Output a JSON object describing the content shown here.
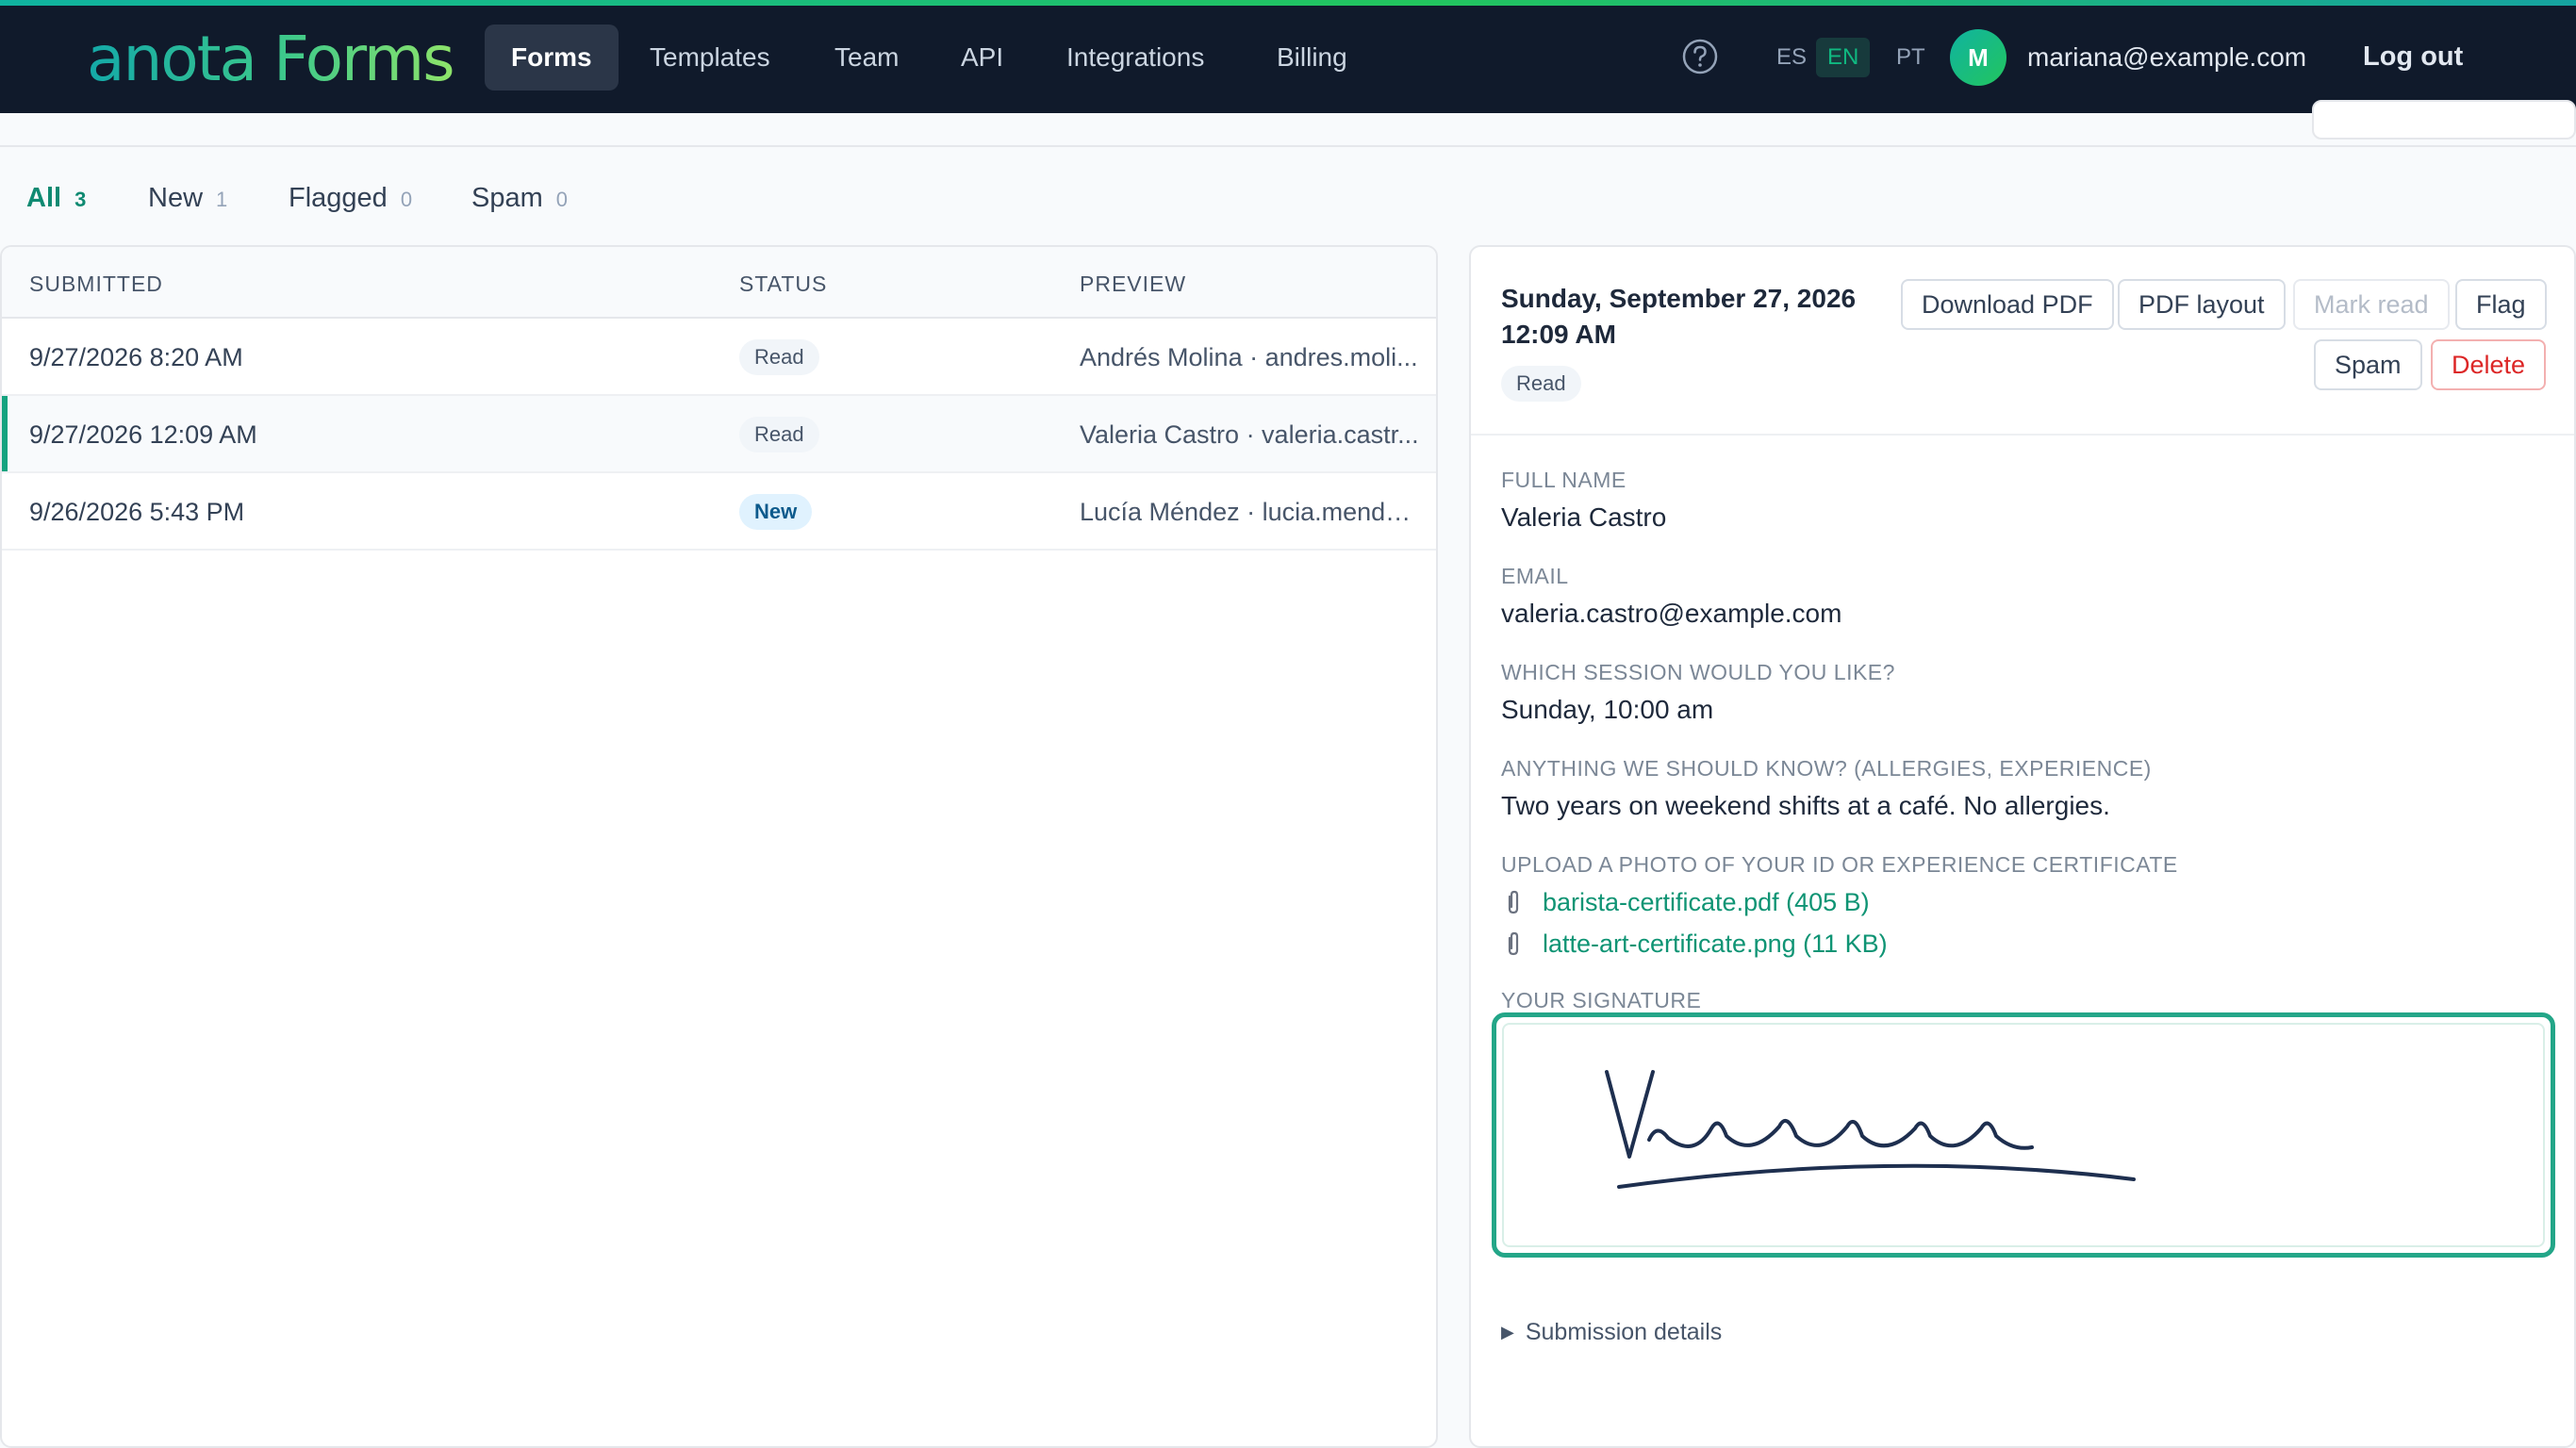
{
  "app": {
    "logo": "anota Forms",
    "nav": [
      {
        "label": "Forms",
        "active": true
      },
      {
        "label": "Templates",
        "active": false
      },
      {
        "label": "Team",
        "active": false
      },
      {
        "label": "API",
        "active": false
      },
      {
        "label": "Integrations",
        "active": false
      },
      {
        "label": "Billing",
        "active": false
      }
    ],
    "help_icon": "question-circle-icon",
    "languages": [
      {
        "code": "ES",
        "active": false
      },
      {
        "code": "EN",
        "active": true
      },
      {
        "code": "PT",
        "active": false
      }
    ],
    "user": {
      "initial": "M",
      "email": "mariana@example.com"
    },
    "logout_label": "Log out",
    "colors": {
      "accent": "#14a37f",
      "nav_bg": "#101a2b",
      "danger": "#dc2626"
    }
  },
  "filters": [
    {
      "label": "All",
      "count": "3",
      "active": true
    },
    {
      "label": "New",
      "count": "1",
      "active": false
    },
    {
      "label": "Flagged",
      "count": "0",
      "active": false
    },
    {
      "label": "Spam",
      "count": "0",
      "active": false
    }
  ],
  "table": {
    "columns": [
      "SUBMITTED",
      "STATUS",
      "PREVIEW"
    ],
    "rows": [
      {
        "submitted": "9/27/2026 8:20 AM",
        "status": "Read",
        "preview": "Andrés Molina · andres.moli...",
        "selected": false
      },
      {
        "submitted": "9/27/2026 12:09 AM",
        "status": "Read",
        "preview": "Valeria Castro · valeria.castr...",
        "selected": true
      },
      {
        "submitted": "9/26/2026 5:43 PM",
        "status": "New",
        "preview": "Lucía Méndez · lucia.mende...",
        "selected": false
      }
    ]
  },
  "detail": {
    "date_line1": "Sunday, September 27, 2026",
    "date_line2": "12:09 AM",
    "status": "Read",
    "actions": {
      "download_pdf": "Download PDF",
      "pdf_layout": "PDF layout",
      "mark_read": "Mark read",
      "flag": "Flag",
      "spam": "Spam",
      "delete": "Delete"
    },
    "fields": [
      {
        "label": "FULL NAME",
        "value": "Valeria Castro"
      },
      {
        "label": "EMAIL",
        "value": "valeria.castro@example.com"
      },
      {
        "label": "WHICH SESSION WOULD YOU LIKE?",
        "value": "Sunday, 10:00 am"
      },
      {
        "label": "ANYTHING WE SHOULD KNOW? (ALLERGIES, EXPERIENCE)",
        "value": "Two years on weekend shifts at a café. No allergies."
      }
    ],
    "upload_label": "UPLOAD A PHOTO OF YOUR ID OR EXPERIENCE CERTIFICATE",
    "attachments": [
      "barista-certificate.pdf (405 B)",
      "latte-art-certificate.png (11 KB)"
    ],
    "signature_label": "YOUR SIGNATURE",
    "submission_details_label": "Submission details"
  }
}
